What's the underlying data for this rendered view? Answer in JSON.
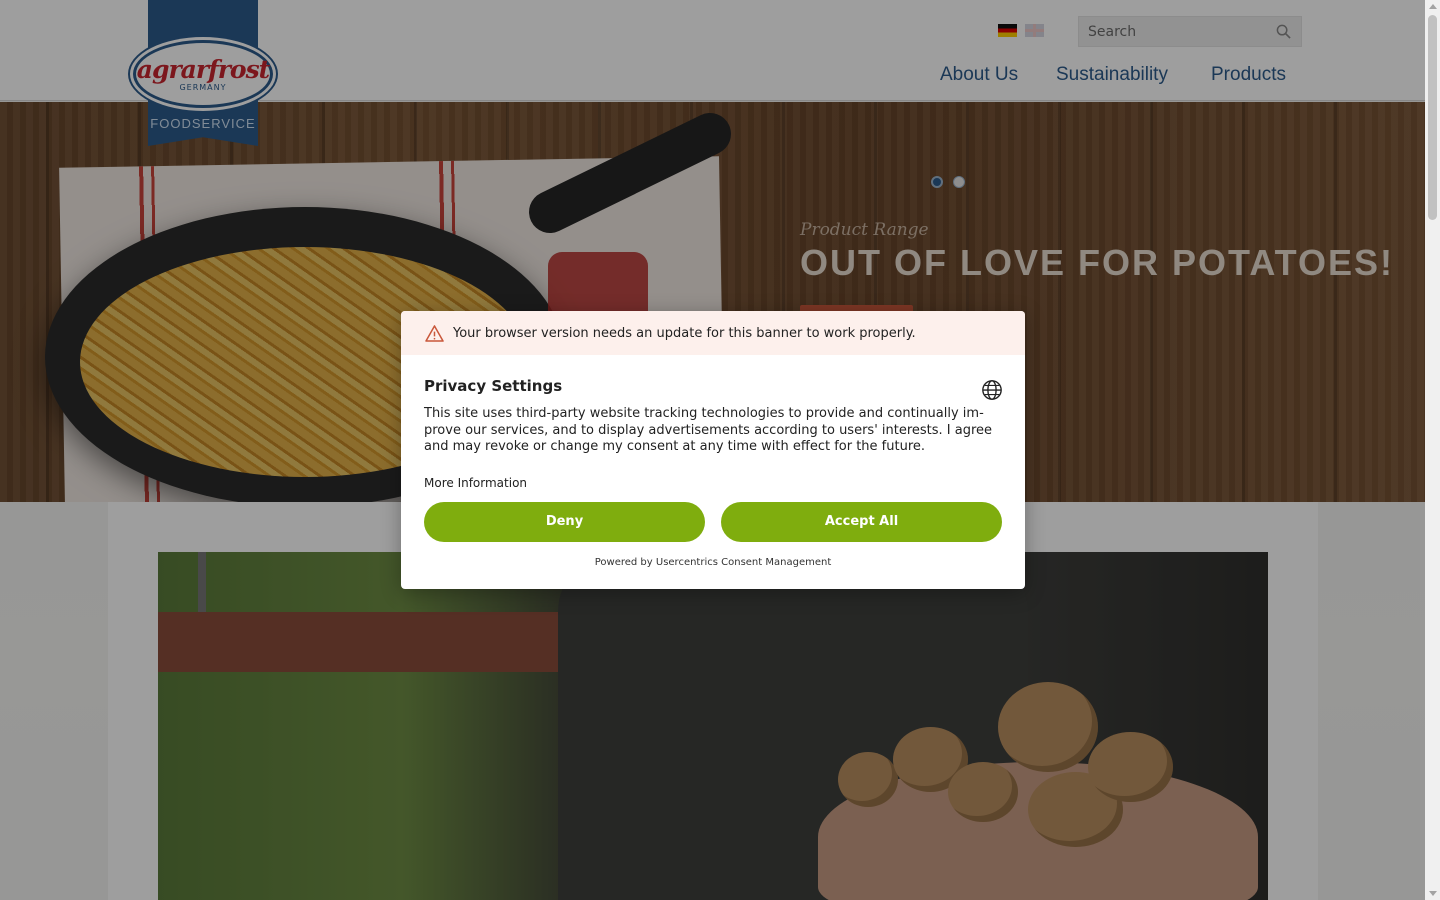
{
  "header": {
    "logo": {
      "brand": "agrarfrost",
      "country": "GERMANY",
      "division": "FOODSERVICE"
    },
    "languages": [
      {
        "code": "de",
        "icon": "german-flag-icon",
        "active": true
      },
      {
        "code": "en",
        "icon": "uk-flag-icon",
        "active": false
      }
    ],
    "search": {
      "placeholder": "Search",
      "value": "",
      "icon": "search-icon"
    },
    "nav": [
      {
        "label": "About Us"
      },
      {
        "label": "Sustainability"
      },
      {
        "label": "Products"
      }
    ]
  },
  "hero": {
    "kicker": "Product Range",
    "title": "OUT OF LOVE FOR POTATOES!",
    "slides_total": 2,
    "active_slide": 1
  },
  "consent_modal": {
    "warning": "Your browser version needs an update for this banner to work properly.",
    "title": "Privacy Settings",
    "description": "This site uses third-party website tracking technologies to provide and continually im-prove our services, and to display advertisements according to users' interests. I agree and may revoke or change my consent at any time with effect for the future.",
    "more_info": "More Information",
    "deny_label": "Deny",
    "accept_label": "Accept All",
    "powered_by": "Powered by Usercentrics Consent Management",
    "colors": {
      "button": "#7fad0e",
      "warning_bg": "#fdf0ec",
      "warning_icon": "#c9573a"
    }
  },
  "colors": {
    "brand_blue": "#2d5b8c",
    "brand_red": "#c8262f"
  }
}
